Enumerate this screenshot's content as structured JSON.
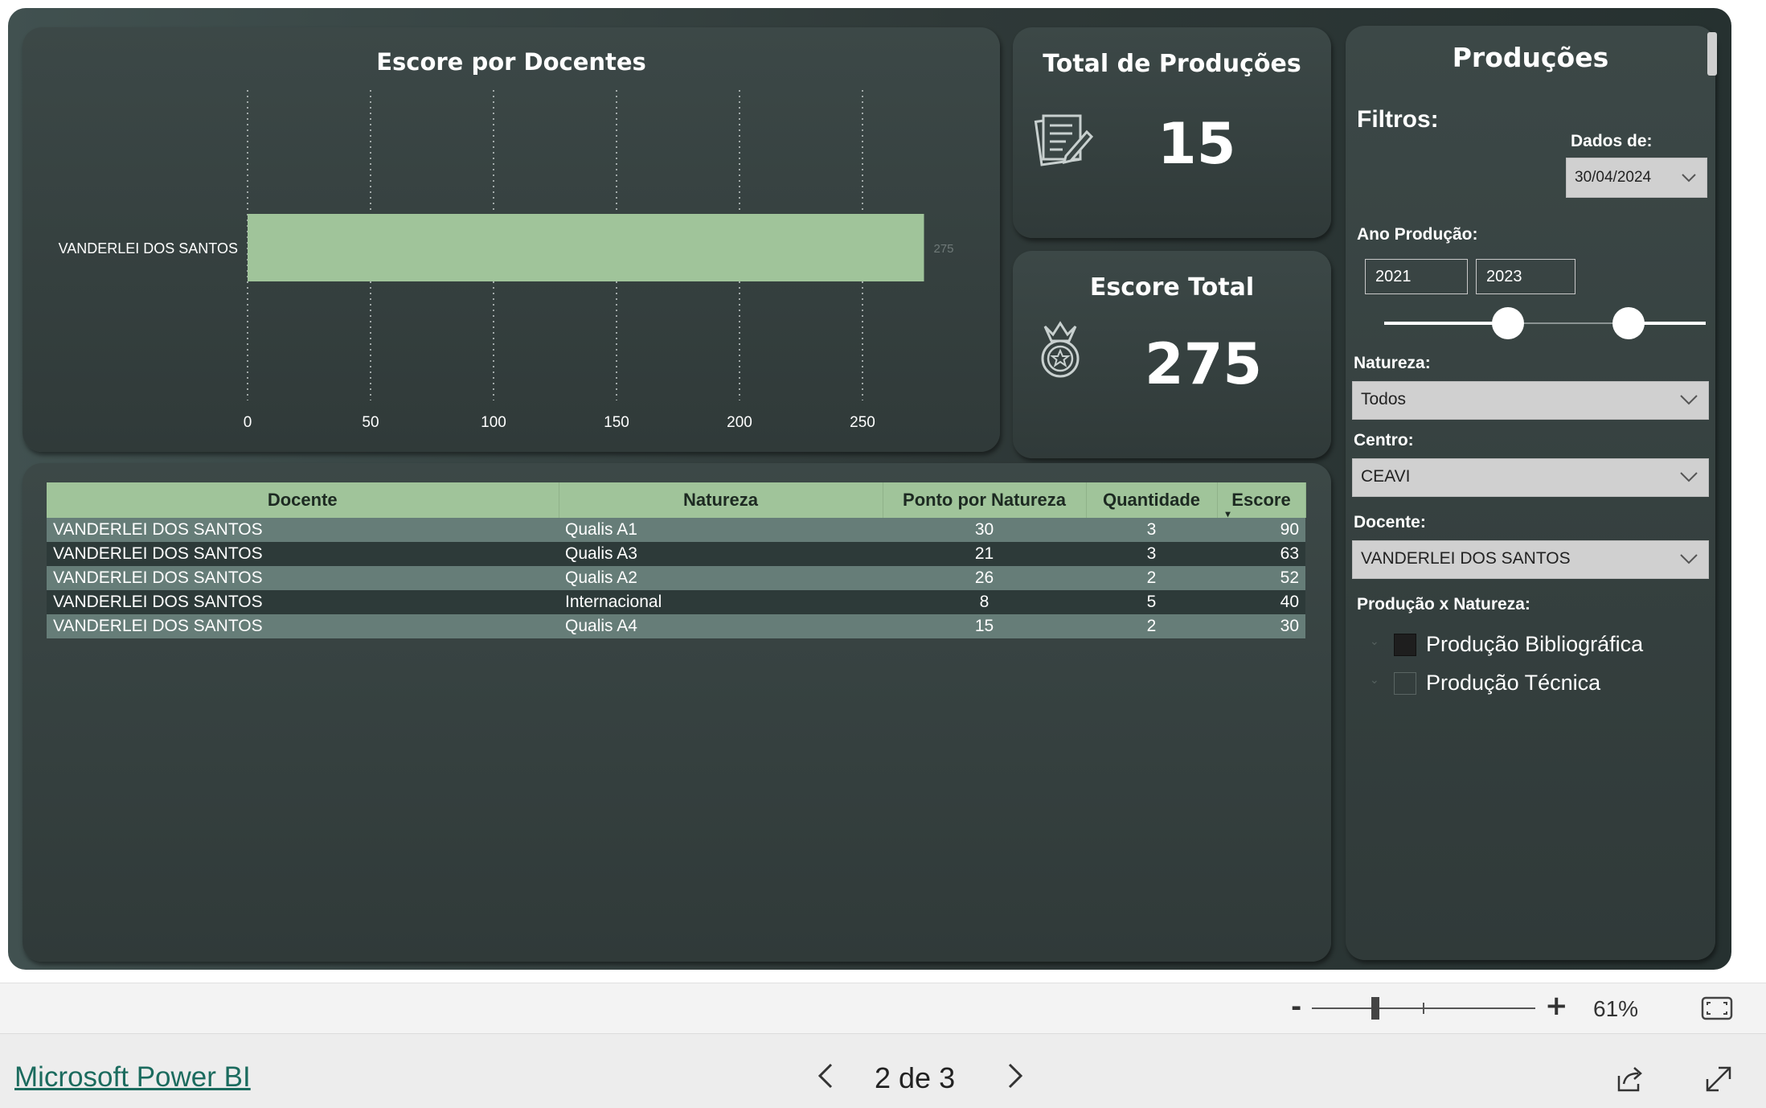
{
  "chart_data": {
    "type": "bar",
    "orientation": "horizontal",
    "title": "Escore por Docentes",
    "categories": [
      "VANDERLEI DOS SANTOS"
    ],
    "values": [
      275
    ],
    "data_labels": [
      "275"
    ],
    "xlim": [
      0,
      275
    ],
    "xticks": [
      0,
      50,
      100,
      150,
      200,
      250
    ],
    "grid": "vertical dotted",
    "bar_color": "#a0c49a"
  },
  "cards": {
    "total": {
      "title": "Total de Produções",
      "value": "15",
      "icon": "document-pen-icon"
    },
    "score": {
      "title": "Escore Total",
      "value": "275",
      "icon": "medal-icon"
    }
  },
  "table": {
    "headers": [
      "Docente",
      "Natureza",
      "Ponto por Natureza",
      "Quantidade",
      "Escore"
    ],
    "rows": [
      [
        "VANDERLEI DOS SANTOS",
        "Qualis A1",
        "30",
        "3",
        "90"
      ],
      [
        "VANDERLEI DOS SANTOS",
        "Qualis A3",
        "21",
        "3",
        "63"
      ],
      [
        "VANDERLEI DOS SANTOS",
        "Qualis A2",
        "26",
        "2",
        "52"
      ],
      [
        "VANDERLEI DOS SANTOS",
        "Internacional",
        "8",
        "5",
        "40"
      ],
      [
        "VANDERLEI DOS SANTOS",
        "Qualis A4",
        "15",
        "2",
        "30"
      ]
    ]
  },
  "filters": {
    "title": "Produções",
    "heading": "Filtros:",
    "data_label": "Dados de:",
    "data_value": "30/04/2024",
    "ano_label": "Ano Produção:",
    "ano_from": "2021",
    "ano_to": "2023",
    "natureza_label": "Natureza:",
    "natureza_value": "Todos",
    "centro_label": "Centro:",
    "centro_value": "CEAVI",
    "docente_label": "Docente:",
    "docente_value": "VANDERLEI DOS SANTOS",
    "prod_label": "Produção x Natureza:",
    "checks": [
      {
        "label": "Produção Bibliográfica",
        "checked": true
      },
      {
        "label": "Produção Técnica",
        "checked": false
      }
    ]
  },
  "zoom": {
    "minus": "-",
    "plus": "+",
    "level": "61%"
  },
  "footer": {
    "brand": "Microsoft Power BI",
    "page": "2 de 3"
  },
  "colors": {
    "accent": "#a0c49a",
    "canvas": "#313c3b",
    "row_light": "#667d78",
    "row_dark": "#2d3a39"
  }
}
